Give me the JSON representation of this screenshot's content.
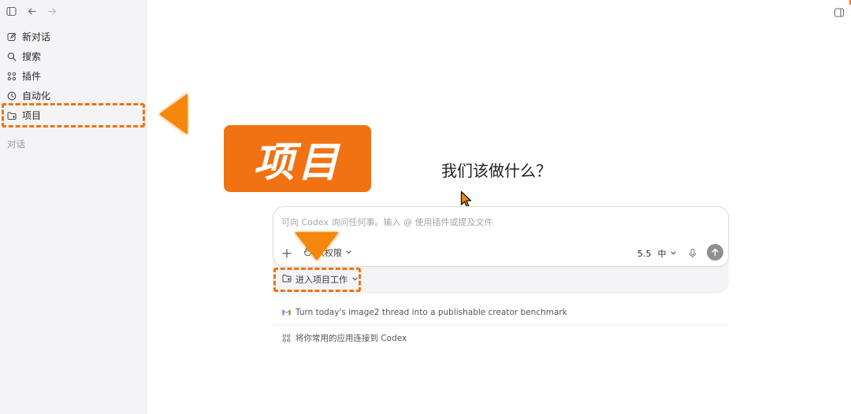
{
  "sidebar": {
    "items": [
      {
        "label": "新对话",
        "icon": "edit-icon"
      },
      {
        "label": "搜索",
        "icon": "search-icon"
      },
      {
        "label": "插件",
        "icon": "grid-icon"
      },
      {
        "label": "自动化",
        "icon": "clock-icon"
      },
      {
        "label": "项目",
        "icon": "folder-icon"
      }
    ],
    "section_label": "对话"
  },
  "annotation": {
    "label": "项目",
    "accent_color": "#f07213"
  },
  "main": {
    "headline": "我们该做什么？",
    "composer": {
      "placeholder": "可向 Codex 询问任何事。输入 @ 使用插件或提及文件",
      "permission_label": "认权限",
      "model_label": "5.5",
      "effort_label": "中"
    },
    "project_button_label": "进入项目工作",
    "suggestions": [
      {
        "label": "Turn today's image2 thread into a publishable creator benchmark",
        "icon": "gmail-icon"
      },
      {
        "label": "将你常用的应用连接到 Codex",
        "icon": "grid-icon"
      }
    ]
  }
}
